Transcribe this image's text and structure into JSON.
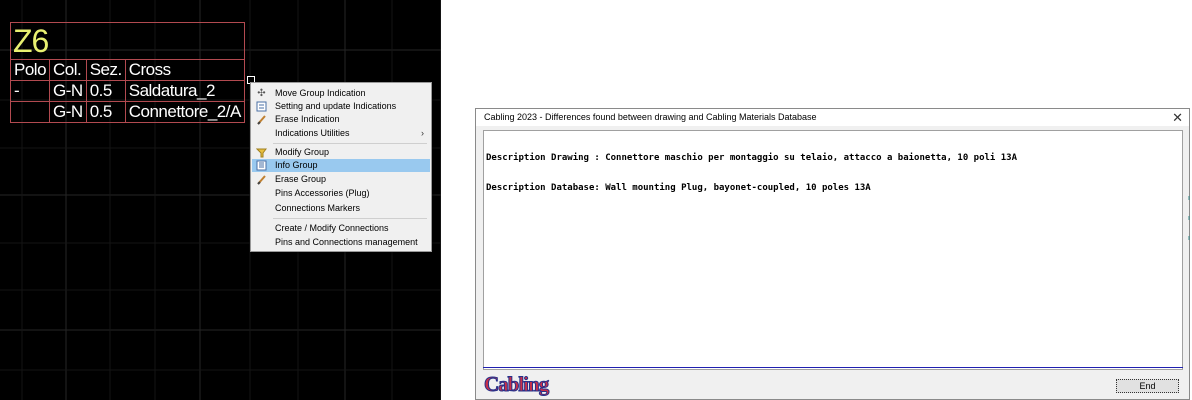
{
  "cad_table": {
    "title": "Z6",
    "headers": [
      "Polo",
      "Col.",
      "Sez.",
      "Cross"
    ],
    "rows": [
      [
        "-",
        "G-N",
        "0.5",
        "Saldatura_2"
      ],
      [
        "",
        "G-N",
        "0.5",
        "Connettore_2/A"
      ]
    ]
  },
  "context_menu": {
    "items": [
      {
        "label": "Move Group Indication",
        "icon": "move-icon"
      },
      {
        "label": "Setting and update Indications",
        "icon": "settings-indications-icon"
      },
      {
        "label": "Erase Indication",
        "icon": "eraser-icon"
      },
      {
        "label": "Indications Utilities",
        "submenu_arrow": "›"
      },
      {
        "label": "Modify Group",
        "icon": "modify-group-icon"
      },
      {
        "label": "Info Group",
        "icon": "info-group-icon",
        "highlighted": true
      },
      {
        "label": "Erase Group",
        "icon": "eraser-icon"
      },
      {
        "label": "Pins Accessories (Plug)"
      },
      {
        "label": "Connections Markers"
      },
      {
        "label": "Create / Modify Connections"
      },
      {
        "label": "Pins and Connections management"
      }
    ]
  },
  "dialog": {
    "title": "Cabling 2023 - Differences found between drawing and Cabling Materials Database",
    "close_glyph": "✕",
    "lines": [
      "Description Drawing : Connettore maschio per montaggio su telaio, attacco a baionetta, 10 poli 13A",
      "Description Database: Wall mounting Plug, bayonet-coupled, 10 poles 13A"
    ],
    "logo": "Cabling",
    "end_button": "End"
  },
  "colors": {
    "canvas": "#000000",
    "table_border": "#b24a50",
    "title_text": "#e8f070",
    "menu_highlight": "#99c9ef",
    "logo_fill": "#c8304a",
    "logo_outline": "#26308a",
    "dialog_separator": "#2020b0"
  }
}
